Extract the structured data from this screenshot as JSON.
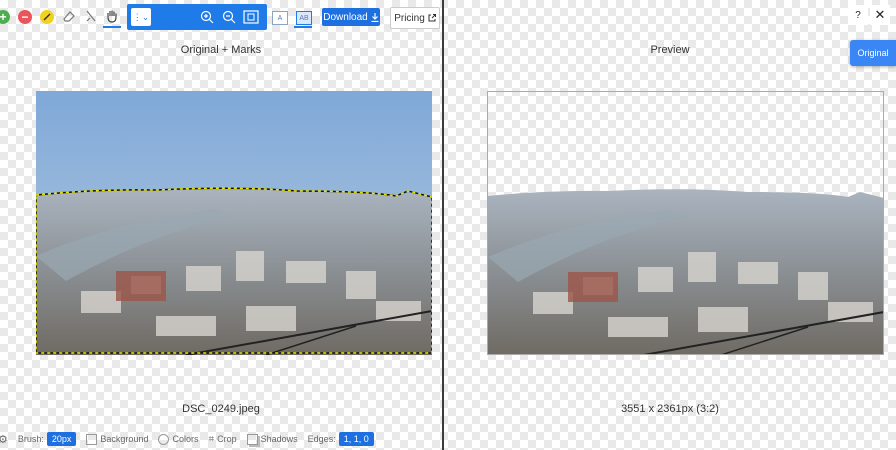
{
  "toolbar": {
    "tools": [
      {
        "name": "add-mark",
        "icon": "plus-icon",
        "color": "#4cae4f"
      },
      {
        "name": "remove-mark",
        "icon": "minus-icon",
        "color": "#e9555a"
      },
      {
        "name": "highlight",
        "icon": "pencil-icon",
        "color": "#f2d21d"
      },
      {
        "name": "eraser",
        "icon": "eraser-icon"
      },
      {
        "name": "brush",
        "icon": "brush-icon"
      },
      {
        "name": "pan",
        "icon": "hand-icon",
        "active": true
      }
    ],
    "zoom_controls": [
      "zoom-in-icon",
      "zoom-out-icon",
      "fit-icon"
    ],
    "download_label": "Download",
    "pricing_label": "Pricing",
    "view_a_label": "A",
    "view_b_label": "AB"
  },
  "left": {
    "title": "Original + Marks",
    "filename": "DSC_0249.jpeg"
  },
  "right": {
    "title": "Preview",
    "dimensions": "3551 x 2361px (3:2)",
    "original_button": "Original",
    "help_label": "?",
    "close_label": "✕"
  },
  "bottom_bar": {
    "brush_label": "Brush:",
    "brush_size": "20px",
    "background_label": "Background",
    "colors_label": "Colors",
    "crop_label": "Crop",
    "shadows_label": "Shadows",
    "edges_label": "Edges:",
    "edges_value": "1, 1, 0"
  },
  "colors": {
    "accent": "#1e7be8",
    "sky": "#8fb3d8",
    "selection": "#e6e600"
  }
}
